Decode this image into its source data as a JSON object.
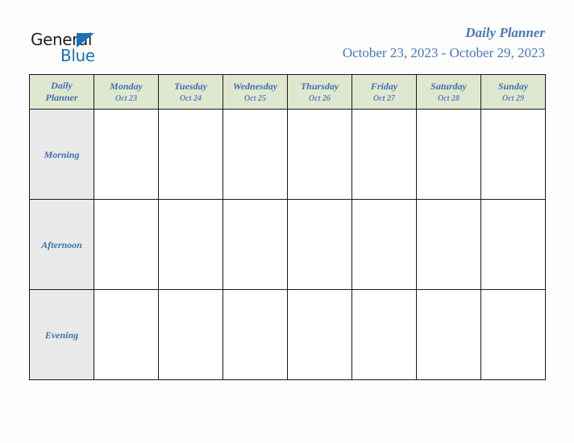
{
  "brand": {
    "name_part1": "General",
    "name_part2": "Blue",
    "triangle_icon": "blue-triangle-icon",
    "colors": {
      "dark": "#231f20",
      "blue": "#1c71b8"
    }
  },
  "header": {
    "title": "Daily Planner",
    "date_range": "October 23, 2023 - October 29, 2023",
    "title_color": "#4a76b8"
  },
  "table": {
    "corner": {
      "line1": "Daily",
      "line2": "Planner"
    },
    "header_bg": "#dfe7cf",
    "row_label_bg": "#e9e9e9",
    "text_color": "#3f72b0",
    "columns": [
      {
        "day": "Monday",
        "date": "Oct 23"
      },
      {
        "day": "Tuesday",
        "date": "Oct 24"
      },
      {
        "day": "Wednesday",
        "date": "Oct 25"
      },
      {
        "day": "Thursday",
        "date": "Oct 26"
      },
      {
        "day": "Friday",
        "date": "Oct 27"
      },
      {
        "day": "Saturday",
        "date": "Oct 28"
      },
      {
        "day": "Sunday",
        "date": "Oct 29"
      }
    ],
    "rows": [
      {
        "label": "Morning",
        "cells": [
          "",
          "",
          "",
          "",
          "",
          "",
          ""
        ]
      },
      {
        "label": "Afternoon",
        "cells": [
          "",
          "",
          "",
          "",
          "",
          "",
          ""
        ]
      },
      {
        "label": "Evening",
        "cells": [
          "",
          "",
          "",
          "",
          "",
          "",
          ""
        ]
      }
    ]
  }
}
